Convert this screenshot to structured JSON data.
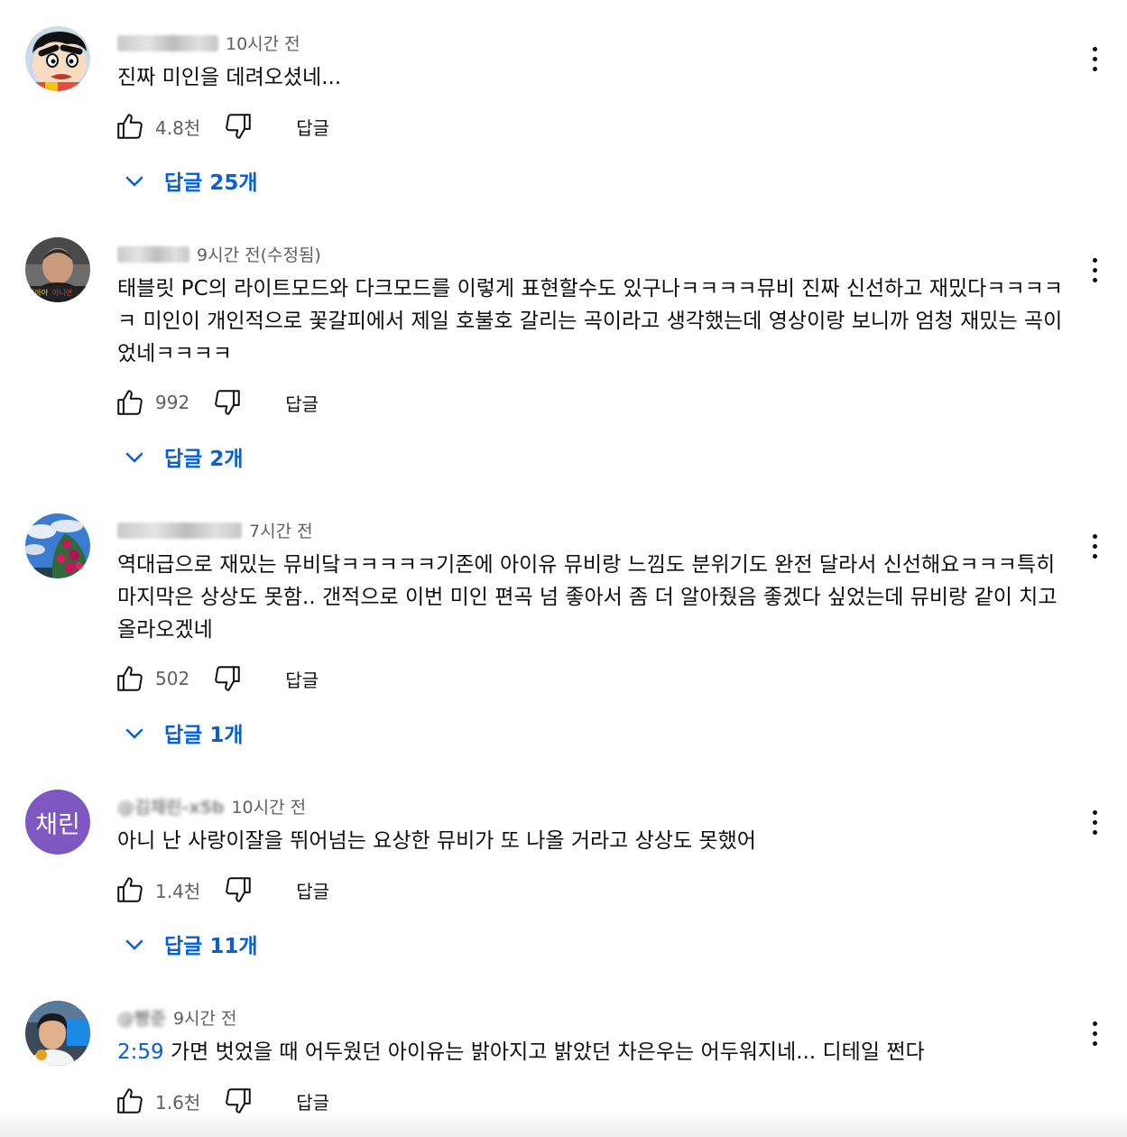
{
  "comments": [
    {
      "author": "@i...k...n",
      "time": "10시간 전",
      "text": "진짜 미인을 데려오셨네...",
      "likes": "4.8천",
      "reply_label": "답글",
      "replies_label": "답글 25개",
      "avatar": "cartoon-avatar"
    },
    {
      "author": "",
      "time": "9시간 전(수정됨)",
      "text": "태블릿 PC의 라이트모드와 다크모드를 이렇게 표현할수도 있구나ㅋㅋㅋㅋ뮤비 진짜 신선하고 재밌다ㅋㅋㅋㅋㅋ 미인이 개인적으로 꽃갈피에서 제일 호불호 갈리는 곡이라고 생각했는데 영상이랑 보니까 엄청 재밌는 곡이었네ㅋㅋㅋㅋ",
      "likes": "992",
      "reply_label": "답글",
      "replies_label": "답글 2개",
      "avatar": "person-photo-avatar"
    },
    {
      "author": "",
      "time": "7시간 전",
      "text": "역대급으로 재밌는 뮤비닼ㅋㅋㅋㅋㅋ기존에 아이유 뮤비랑 느낌도 분위기도 완전 달라서 신선해요ㅋㅋㅋ특히 마지막은 상상도 못함.. 갠적으로 이번 미인 편곡 넘 좋아서 좀 더 알아줬음 좋겠다 싶었는데 뮤비랑 같이 치고 올라오겠네",
      "likes": "502",
      "reply_label": "답글",
      "replies_label": "답글 1개",
      "avatar": "sky-flower-avatar"
    },
    {
      "author": "@김채린-x5b",
      "time": "10시간 전",
      "text": "아니 난 사랑이잘을 뛰어넘는 요상한 뮤비가 또 나올 거라고 상상도 못했어",
      "likes": "1.4천",
      "reply_label": "답글",
      "replies_label": "답글 11개",
      "avatar_text": "채린",
      "avatar_color": "#7e57c2"
    },
    {
      "author": "@빵준",
      "time": "9시간 전",
      "timestamp": "2:59",
      "text": " 가면 벗었을 때 어두웠던 아이유는 밝아지고 밝았던 차은우는 어두워지네... 디테일 쩐다",
      "likes": "1.6천",
      "reply_label": "답글",
      "avatar": "portrait-avatar"
    }
  ],
  "colors": {
    "link_blue": "#065fd4",
    "meta_gray": "#606060",
    "text": "#0f0f0f"
  }
}
